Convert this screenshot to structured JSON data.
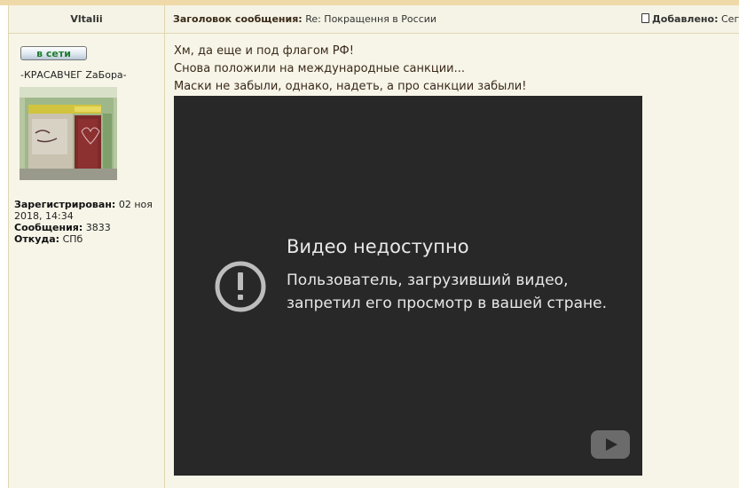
{
  "author": {
    "name": "Vltalii"
  },
  "header": {
    "subject_label": "Заголовок сообщения:",
    "subject": "Re: Покращення в России",
    "added_label": "Добавлено:",
    "added_value": "Сег"
  },
  "user": {
    "online_label": "в сети",
    "status": "-КРАСАВЧЕГ ZaБора-",
    "registered_label": "Зарегистрирован:",
    "registered_value": "02 ноя 2018, 14:34",
    "posts_label": "Сообщения:",
    "posts_value": "3833",
    "location_label": "Откуда:",
    "location_value": "СПб"
  },
  "post": {
    "lines": [
      "Хм, да еще и под флагом РФ!",
      "Снова положили на международные санкции...",
      "Маски не забыли, однако, надеть, а про санкции забыли!"
    ]
  },
  "video": {
    "title": "Видео недоступно",
    "message": "Пользователь, загрузивший видео, запретил его просмотр в вашей стране.",
    "icon": "exclamation-circle-icon",
    "logo": "youtube-logo-icon"
  },
  "colors": {
    "panel_bg": "#f7f5e8",
    "header_bg": "#f5f3e5",
    "video_bg": "#282828",
    "online_text": "#1f7b2e"
  }
}
